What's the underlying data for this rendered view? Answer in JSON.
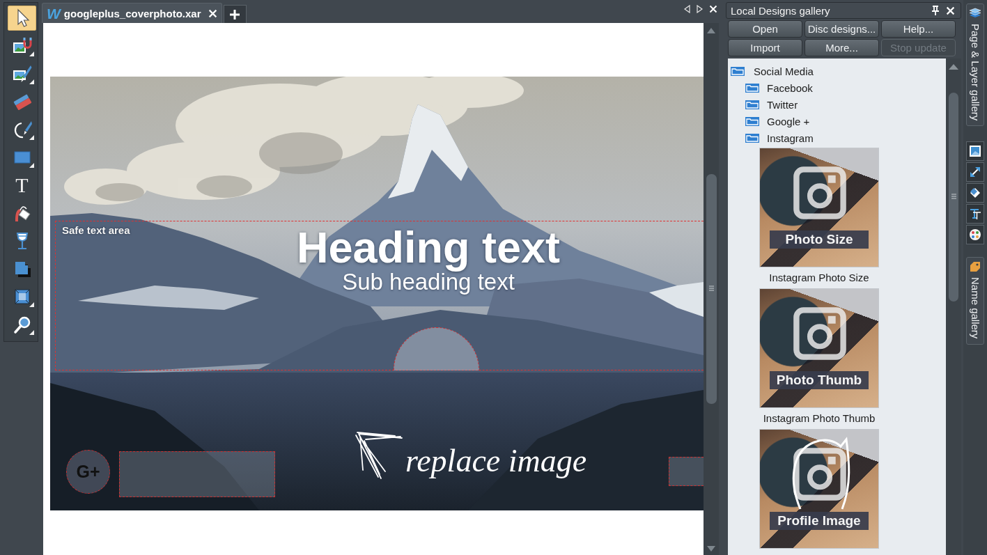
{
  "toolbar": {
    "tools": [
      {
        "selected": true,
        "flyout": false
      },
      {
        "selected": false,
        "flyout": true
      },
      {
        "selected": false,
        "flyout": true
      },
      {
        "selected": false,
        "flyout": false
      },
      {
        "selected": false,
        "flyout": true
      },
      {
        "selected": false,
        "flyout": true
      },
      {
        "selected": false,
        "flyout": false,
        "glyph": "T"
      },
      {
        "selected": false,
        "flyout": false
      },
      {
        "selected": false,
        "flyout": false
      },
      {
        "selected": false,
        "flyout": false
      },
      {
        "selected": false,
        "flyout": true
      },
      {
        "selected": false,
        "flyout": true
      }
    ]
  },
  "document": {
    "tabs": [
      {
        "icon_letter": "W",
        "title": "googleplus_coverphoto.xar",
        "selected": true
      }
    ],
    "canvas": {
      "safe_area_label": "Safe text area",
      "heading": "Heading text",
      "subheading": "Sub heading text",
      "social_badge": "G+",
      "hint": "replace image"
    }
  },
  "gallery": {
    "title": "Local Designs gallery",
    "buttons": [
      {
        "label": "Open",
        "disabled": false
      },
      {
        "label": "Disc designs...",
        "disabled": false
      },
      {
        "label": "Help...",
        "disabled": false
      },
      {
        "label": "Import",
        "disabled": false
      },
      {
        "label": "More...",
        "disabled": false
      },
      {
        "label": "Stop update",
        "disabled": true
      }
    ],
    "tree": [
      {
        "label": "Social Media",
        "children": [
          {
            "label": "Facebook"
          },
          {
            "label": "Twitter"
          },
          {
            "label": "Google +"
          },
          {
            "label": "Instagram",
            "designs": [
              {
                "label": "Instagram Photo Size",
                "banner": "Photo Size",
                "kind": "photo"
              },
              {
                "label": "Instagram Photo Thumb",
                "banner": "Photo Thumb",
                "kind": "photo"
              },
              {
                "banner": "Profile Image",
                "kind": "profile"
              }
            ]
          }
        ]
      }
    ]
  },
  "side_bar": {
    "tabs": [
      {
        "label": "Page & Layer gallery"
      },
      {
        "label": "Name gallery"
      }
    ]
  }
}
